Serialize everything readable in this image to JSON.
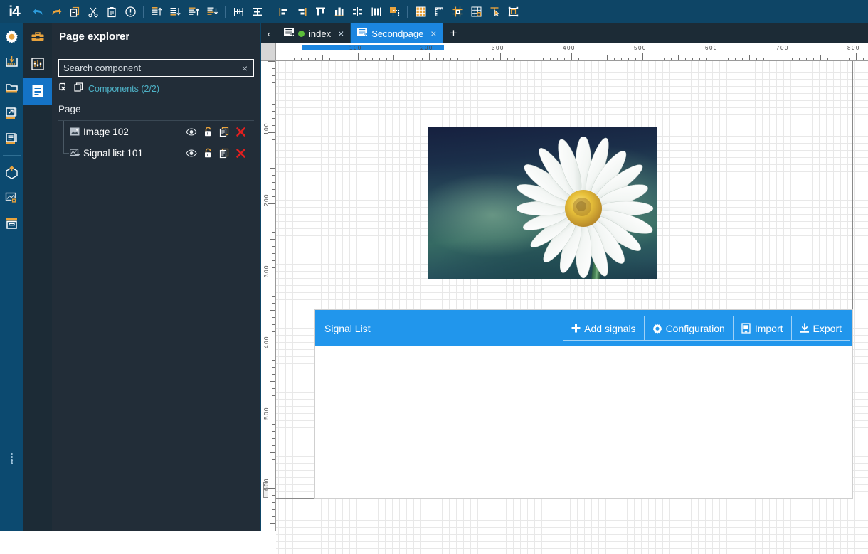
{
  "app": {
    "brand": "i4"
  },
  "toolbar": {
    "items": [
      {
        "name": "undo-icon",
        "title": "Undo"
      },
      {
        "name": "redo-icon",
        "title": "Redo"
      },
      {
        "name": "copy-icon",
        "title": "Copy"
      },
      {
        "name": "cut-icon",
        "title": "Cut"
      },
      {
        "name": "paste-icon",
        "title": "Paste"
      },
      {
        "name": "info-icon",
        "title": "Info"
      },
      {
        "name": "align-top-icon",
        "title": "Align top"
      },
      {
        "name": "align-bottom-icon",
        "title": "Align bottom"
      },
      {
        "name": "align-left-icon",
        "title": "Align left"
      },
      {
        "name": "align-right-icon",
        "title": "Align right"
      },
      {
        "name": "distribute-horizontal-icon",
        "title": "Distribute horizontally"
      },
      {
        "name": "distribute-vertical-icon",
        "title": "Distribute vertically"
      },
      {
        "name": "align-edge-left-icon",
        "title": "Align edge left"
      },
      {
        "name": "align-edge-right-icon",
        "title": "Align edge right"
      },
      {
        "name": "align-center-vertical-icon",
        "title": "Center vertically"
      },
      {
        "name": "align-center-horizontal-icon",
        "title": "Center horizontally"
      },
      {
        "name": "same-width-icon",
        "title": "Same width"
      },
      {
        "name": "same-height-icon",
        "title": "Same height"
      },
      {
        "name": "group-icon",
        "title": "Group"
      },
      {
        "name": "grid-show-icon",
        "title": "Show grid"
      },
      {
        "name": "ruler-icon",
        "title": "Ruler"
      },
      {
        "name": "snap-grid-icon",
        "title": "Snap to grid"
      },
      {
        "name": "grid-settings-icon",
        "title": "Grid settings"
      },
      {
        "name": "select-tool-icon",
        "title": "Select tool"
      },
      {
        "name": "bounding-box-icon",
        "title": "Bounding box"
      }
    ]
  },
  "rail": {
    "items": [
      {
        "name": "sidebar-item-settings",
        "label": "Settings"
      },
      {
        "name": "sidebar-item-import-data",
        "label": "Import data"
      },
      {
        "name": "sidebar-item-folder",
        "label": "Folder"
      },
      {
        "name": "sidebar-item-export",
        "label": "Export"
      },
      {
        "name": "sidebar-item-list",
        "label": "List"
      },
      {
        "name": "sidebar-item-deploy",
        "label": "Deploy"
      },
      {
        "name": "sidebar-item-media-settings",
        "label": "Media settings"
      },
      {
        "name": "sidebar-item-archive",
        "label": "Archive"
      }
    ]
  },
  "rail2": {
    "items": [
      {
        "name": "tool-toolbox",
        "label": "Toolbox",
        "active": false
      },
      {
        "name": "tool-properties",
        "label": "Properties",
        "active": false
      },
      {
        "name": "tool-page-explorer",
        "label": "Page explorer",
        "active": true
      }
    ]
  },
  "explorer": {
    "title": "Page explorer",
    "search": {
      "value": "",
      "placeholder": "Search component",
      "clear": "×"
    },
    "components_label": "Components (2/2)",
    "page_label": "Page",
    "tree": [
      {
        "name": "Image 102",
        "icon": "image-icon"
      },
      {
        "name": "Signal list 101",
        "icon": "signal-list-icon"
      }
    ],
    "row_actions": [
      {
        "name": "visibility-toggle",
        "label": "Visibility"
      },
      {
        "name": "lock-toggle",
        "label": "Lock"
      },
      {
        "name": "duplicate-button",
        "label": "Duplicate"
      },
      {
        "name": "delete-button",
        "label": "Delete"
      }
    ]
  },
  "tabs": {
    "scroll_left": "‹",
    "add": "+",
    "items": [
      {
        "label": "index",
        "active": false,
        "dirty_dot": true,
        "close": "×"
      },
      {
        "label": "Secondpage",
        "active": true,
        "dirty_dot": false,
        "close": "×"
      }
    ]
  },
  "rulers": {
    "horizontal_ticks": [
      "100",
      "200",
      "300",
      "400",
      "500",
      "600",
      "700",
      "800"
    ],
    "vertical_ticks": [
      "100",
      "200",
      "300",
      "400",
      "500",
      "600"
    ],
    "unit_step": 100
  },
  "canvas": {
    "image_component": {
      "name": "Image 102",
      "alt": "White daisy flower on blurred dark blue green background"
    },
    "signal_list": {
      "title": "Signal List",
      "buttons": [
        {
          "label": "Add signals",
          "icon": "plus-icon"
        },
        {
          "label": "Configuration",
          "icon": "gear-icon"
        },
        {
          "label": "Import",
          "icon": "import-icon"
        },
        {
          "label": "Export",
          "icon": "export-icon"
        }
      ]
    }
  },
  "colors": {
    "toolbar_bg": "#0e4566",
    "rail_bg": "#0c4a70",
    "panel_bg": "#222d38",
    "accent_blue": "#1b86e0",
    "accent_orange": "#e8a33d",
    "signal_blue": "#2196ec",
    "teal_text": "#4eb3c8",
    "delete_red": "#e02020",
    "dot_green": "#5bbd3a"
  }
}
